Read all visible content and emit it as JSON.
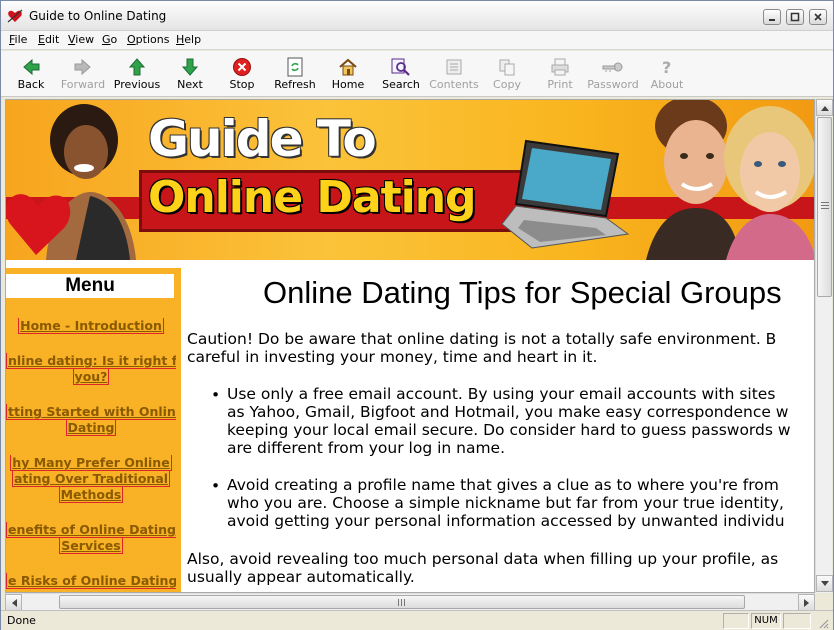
{
  "window": {
    "title": "Guide to Online Dating"
  },
  "menubar": {
    "items": [
      {
        "label": "File",
        "key": "F",
        "rest": "ile"
      },
      {
        "label": "Edit",
        "key": "E",
        "rest": "dit"
      },
      {
        "label": "View",
        "key": "V",
        "rest": "iew"
      },
      {
        "label": "Go",
        "key": "G",
        "rest": "o"
      },
      {
        "label": "Options",
        "key": "O",
        "rest": "ptions"
      },
      {
        "label": "Help",
        "key": "H",
        "rest": "elp"
      }
    ]
  },
  "toolbar": {
    "back": "Back",
    "forward": "Forward",
    "previous": "Previous",
    "next": "Next",
    "stop": "Stop",
    "refresh": "Refresh",
    "home": "Home",
    "search": "Search",
    "contents": "Contents",
    "copy": "Copy",
    "print": "Print",
    "password": "Password",
    "about": "About"
  },
  "banner": {
    "line1": "Guide To",
    "line2": "Online Dating"
  },
  "sidebar": {
    "heading": "Menu",
    "links": [
      [
        "Home - Introduction"
      ],
      [
        "nline dating: Is it right for",
        "you?"
      ],
      [
        "tting Started with Online",
        "Dating"
      ],
      [
        "hy Many Prefer Online",
        "ating Over Traditional",
        "Methods"
      ],
      [
        "enefits of Online Dating",
        "Services"
      ],
      [
        "e Risks of Online Dating"
      ]
    ]
  },
  "article": {
    "heading": "Online Dating Tips for Special Groups",
    "intro": [
      "Caution! Do be aware that online dating is not a totally safe environment. B",
      "careful in investing your money, time and heart in it."
    ],
    "bullet1": [
      "Use only a free email account. By using your email accounts with sites",
      "as Yahoo, Gmail, Bigfoot and Hotmail, you make easy correspondence w",
      "keeping your local email secure. Do consider hard to guess passwords w",
      "are different from your log in name."
    ],
    "bullet2": [
      "Avoid creating a profile name that gives a clue as to where you're from",
      "who you are. Choose a simple nickname but far from your true identity,",
      "avoid getting your personal information accessed by unwanted individu"
    ],
    "outro": [
      "Also, avoid revealing too much personal data when filling up your profile, as",
      "usually appear automatically."
    ]
  },
  "status": {
    "text": "Done",
    "num": "NUM"
  },
  "colors": {
    "banner_orange": "#f9b126",
    "banner_red": "#c8151a",
    "link_border": "#e0252a"
  }
}
